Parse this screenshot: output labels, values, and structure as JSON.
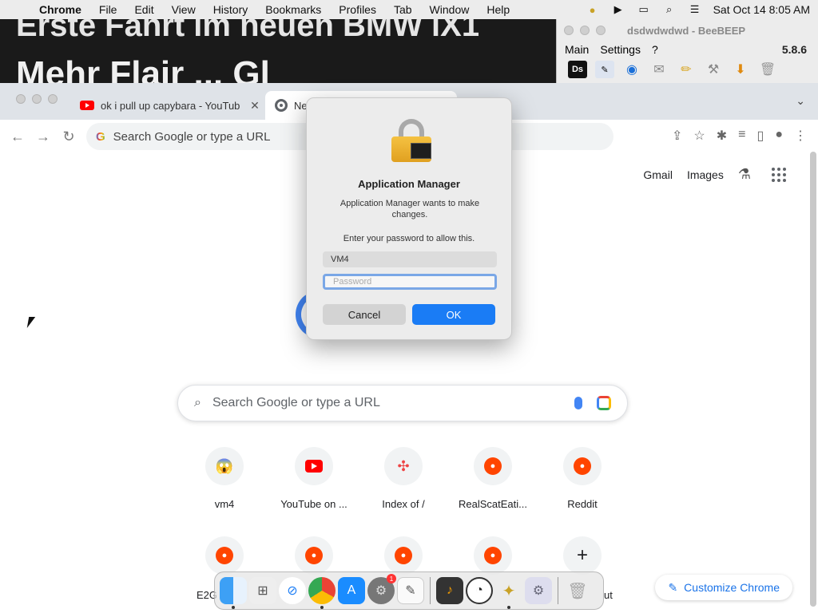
{
  "menubar": {
    "app": "Chrome",
    "items": [
      "File",
      "Edit",
      "View",
      "History",
      "Bookmarks",
      "Profiles",
      "Tab",
      "Window",
      "Help"
    ],
    "datetime": "Sat Oct 14  8:05 AM"
  },
  "background_video": {
    "line1": "Erste Fahrt im neuen BMW iX1",
    "line2": "Mehr Flair ... Gl"
  },
  "beebeep": {
    "title": "dsdwdwdwd - BeeBEEP",
    "menu": [
      "Main",
      "Settings",
      "?"
    ],
    "version": "5.8.6",
    "toolbar_icons": [
      "ds-icon",
      "edit-icon",
      "network-icon",
      "mail-icon",
      "pencil-icon",
      "tools-icon",
      "download-icon",
      "trash-icon"
    ]
  },
  "chrome": {
    "tabs": [
      {
        "title": "ok i pull up capybara - YouTub",
        "icon": "youtube-icon"
      },
      {
        "title": "Ne",
        "icon": "chrome-icon"
      }
    ],
    "omnibox_placeholder": "Search Google or type a URL",
    "ntp": {
      "gmail": "Gmail",
      "images": "Images",
      "search_placeholder": "Search Google or type a URL",
      "shortcuts_row1": [
        {
          "label": "vm4",
          "icon": "vm4-icon"
        },
        {
          "label": "YouTube on ...",
          "icon": "youtube-icon"
        },
        {
          "label": "Index of /",
          "icon": "joomla-icon"
        },
        {
          "label": "RealScatEati...",
          "icon": "reddit-icon"
        },
        {
          "label": "Reddit",
          "icon": "reddit-icon"
        }
      ],
      "shortcuts_row2_partial_left": "E2G",
      "shortcuts_row2_partial_right": "ut",
      "customize": "Customize Chrome"
    }
  },
  "dialog": {
    "title": "Application Manager",
    "message": "Application Manager wants to make changes.",
    "prompt": "Enter your password to allow this.",
    "username": "VM4",
    "password_placeholder": "Password",
    "cancel": "Cancel",
    "ok": "OK"
  },
  "dock": {
    "apps": [
      "finder-icon",
      "launchpad-icon",
      "safari-icon",
      "chrome-icon",
      "app-store-icon",
      "system-settings-icon",
      "textedit-icon",
      "guitar-icon",
      "clock-icon",
      "beebeep-icon",
      "utility-icon",
      "trash-icon"
    ],
    "settings_badge": "1"
  }
}
